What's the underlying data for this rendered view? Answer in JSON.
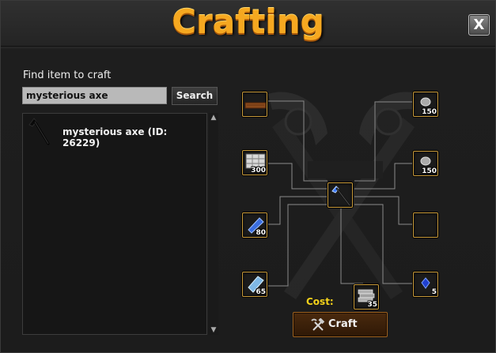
{
  "window": {
    "title": "Crafting",
    "close_label": "X"
  },
  "search": {
    "label": "Find item to craft",
    "value": "mysterious axe",
    "button_label": "Search"
  },
  "results": [
    {
      "name": "mysterious axe (ID: 26229)",
      "icon": "axe-icon"
    }
  ],
  "recipe": {
    "result_icon": "mysterious-axe-icon",
    "ingredients": [
      {
        "icon": "plank-icon",
        "qty": ""
      },
      {
        "icon": "bricks-icon",
        "qty": "300"
      },
      {
        "icon": "blue-gem-icon",
        "qty": "80"
      },
      {
        "icon": "crystal-shard-icon",
        "qty": "65"
      },
      {
        "icon": "ore-icon",
        "qty": "150"
      },
      {
        "icon": "ore-icon",
        "qty": "150"
      },
      {
        "icon": "empty-slot",
        "qty": ""
      },
      {
        "icon": "sapphire-icon",
        "qty": "5"
      }
    ],
    "cost_label": "Cost:",
    "cost_icon": "coin-stack-icon",
    "cost_qty": "35"
  },
  "craft_button": {
    "label": "Craft",
    "icon": "hammer-pick-icon"
  },
  "colors": {
    "accent": "#f6a820",
    "slot_border": "#c89a3a",
    "cost_label": "#f3d21a"
  }
}
